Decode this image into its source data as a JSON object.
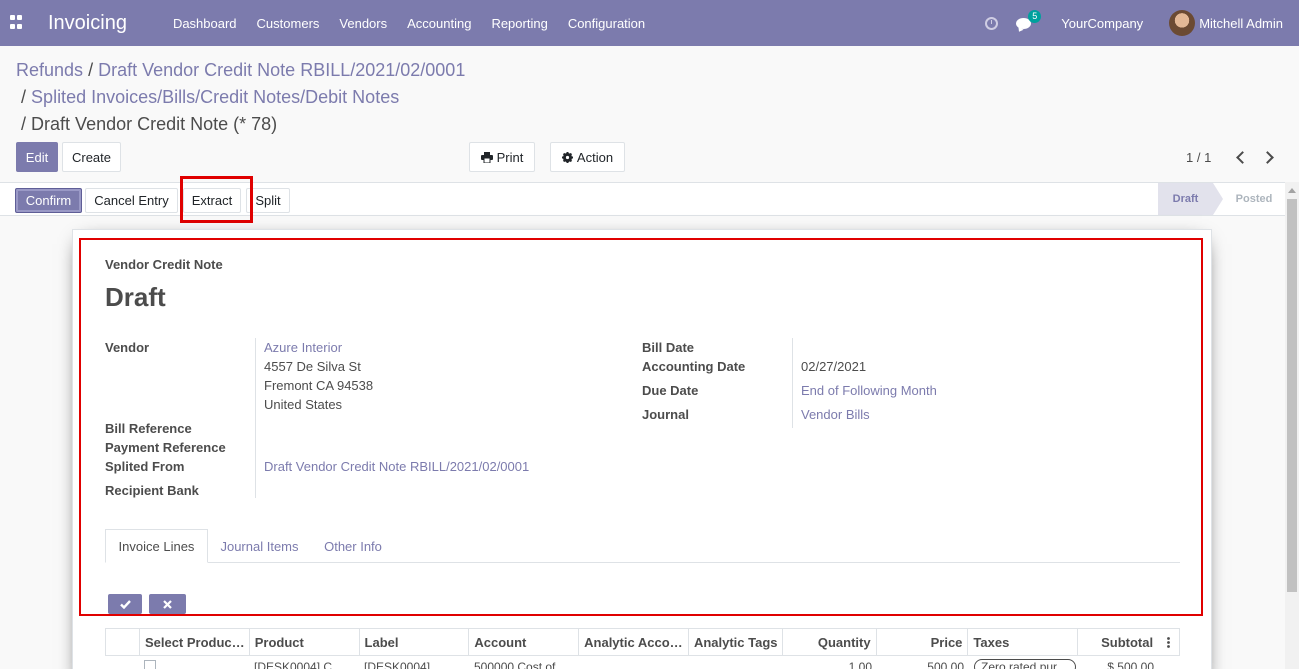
{
  "nav": {
    "app_name": "Invoicing",
    "menu": [
      "Dashboard",
      "Customers",
      "Vendors",
      "Accounting",
      "Reporting",
      "Configuration"
    ],
    "chat_count": "5",
    "company": "YourCompany",
    "user": "Mitchell Admin"
  },
  "breadcrumb": {
    "item1": "Refunds",
    "item2": "Draft Vendor Credit Note RBILL/2021/02/0001",
    "item3": "Splited Invoices/Bills/Credit Notes/Debit Notes",
    "current": "Draft Vendor Credit Note (* 78)",
    "sep": "/"
  },
  "controls": {
    "edit": "Edit",
    "create": "Create",
    "print": "Print",
    "action": "Action",
    "pager": "1 / 1"
  },
  "statusbar": {
    "confirm": "Confirm",
    "cancel_entry": "Cancel Entry",
    "extract": "Extract",
    "split": "Split",
    "stages": [
      "Draft",
      "Posted"
    ],
    "active_stage": "Draft"
  },
  "form": {
    "doc_type": "Vendor Credit Note",
    "title": "Draft",
    "vendor_label": "Vendor",
    "vendor_name": "Azure Interior",
    "vendor_address": [
      "4557 De Silva St",
      "Fremont CA 94538",
      "United States"
    ],
    "bill_reference_label": "Bill Reference",
    "payment_reference_label": "Payment Reference",
    "splited_from_label": "Splited From",
    "splited_from_value": "Draft Vendor Credit Note RBILL/2021/02/0001",
    "recipient_bank_label": "Recipient Bank",
    "bill_date_label": "Bill Date",
    "accounting_date_label": "Accounting Date",
    "accounting_date_value": "02/27/2021",
    "due_date_label": "Due Date",
    "due_date_value": "End of Following Month",
    "journal_label": "Journal",
    "journal_value": "Vendor Bills"
  },
  "tabs": [
    "Invoice Lines",
    "Journal Items",
    "Other Info"
  ],
  "table": {
    "headers": [
      "Select Produc…",
      "Product",
      "Label",
      "Account",
      "Analytic Acco…",
      "Analytic Tags",
      "Quantity",
      "Price",
      "Taxes",
      "Subtotal"
    ],
    "row1": [
      "[DESK0004] C…",
      "[DESK0004]…",
      "500000 Cost of…",
      "",
      "",
      "1.00",
      "500.00",
      "Zero rated pur…",
      "$ 500.00"
    ]
  },
  "colors": {
    "brand": "#7c7bad",
    "highlight": "#e00000"
  },
  "icons": [
    "apps-icon",
    "clock-icon",
    "chat-icon",
    "print-icon",
    "gear-icon",
    "chevron-left-icon",
    "chevron-right-icon",
    "check-icon",
    "close-icon",
    "column-options-icon"
  ]
}
